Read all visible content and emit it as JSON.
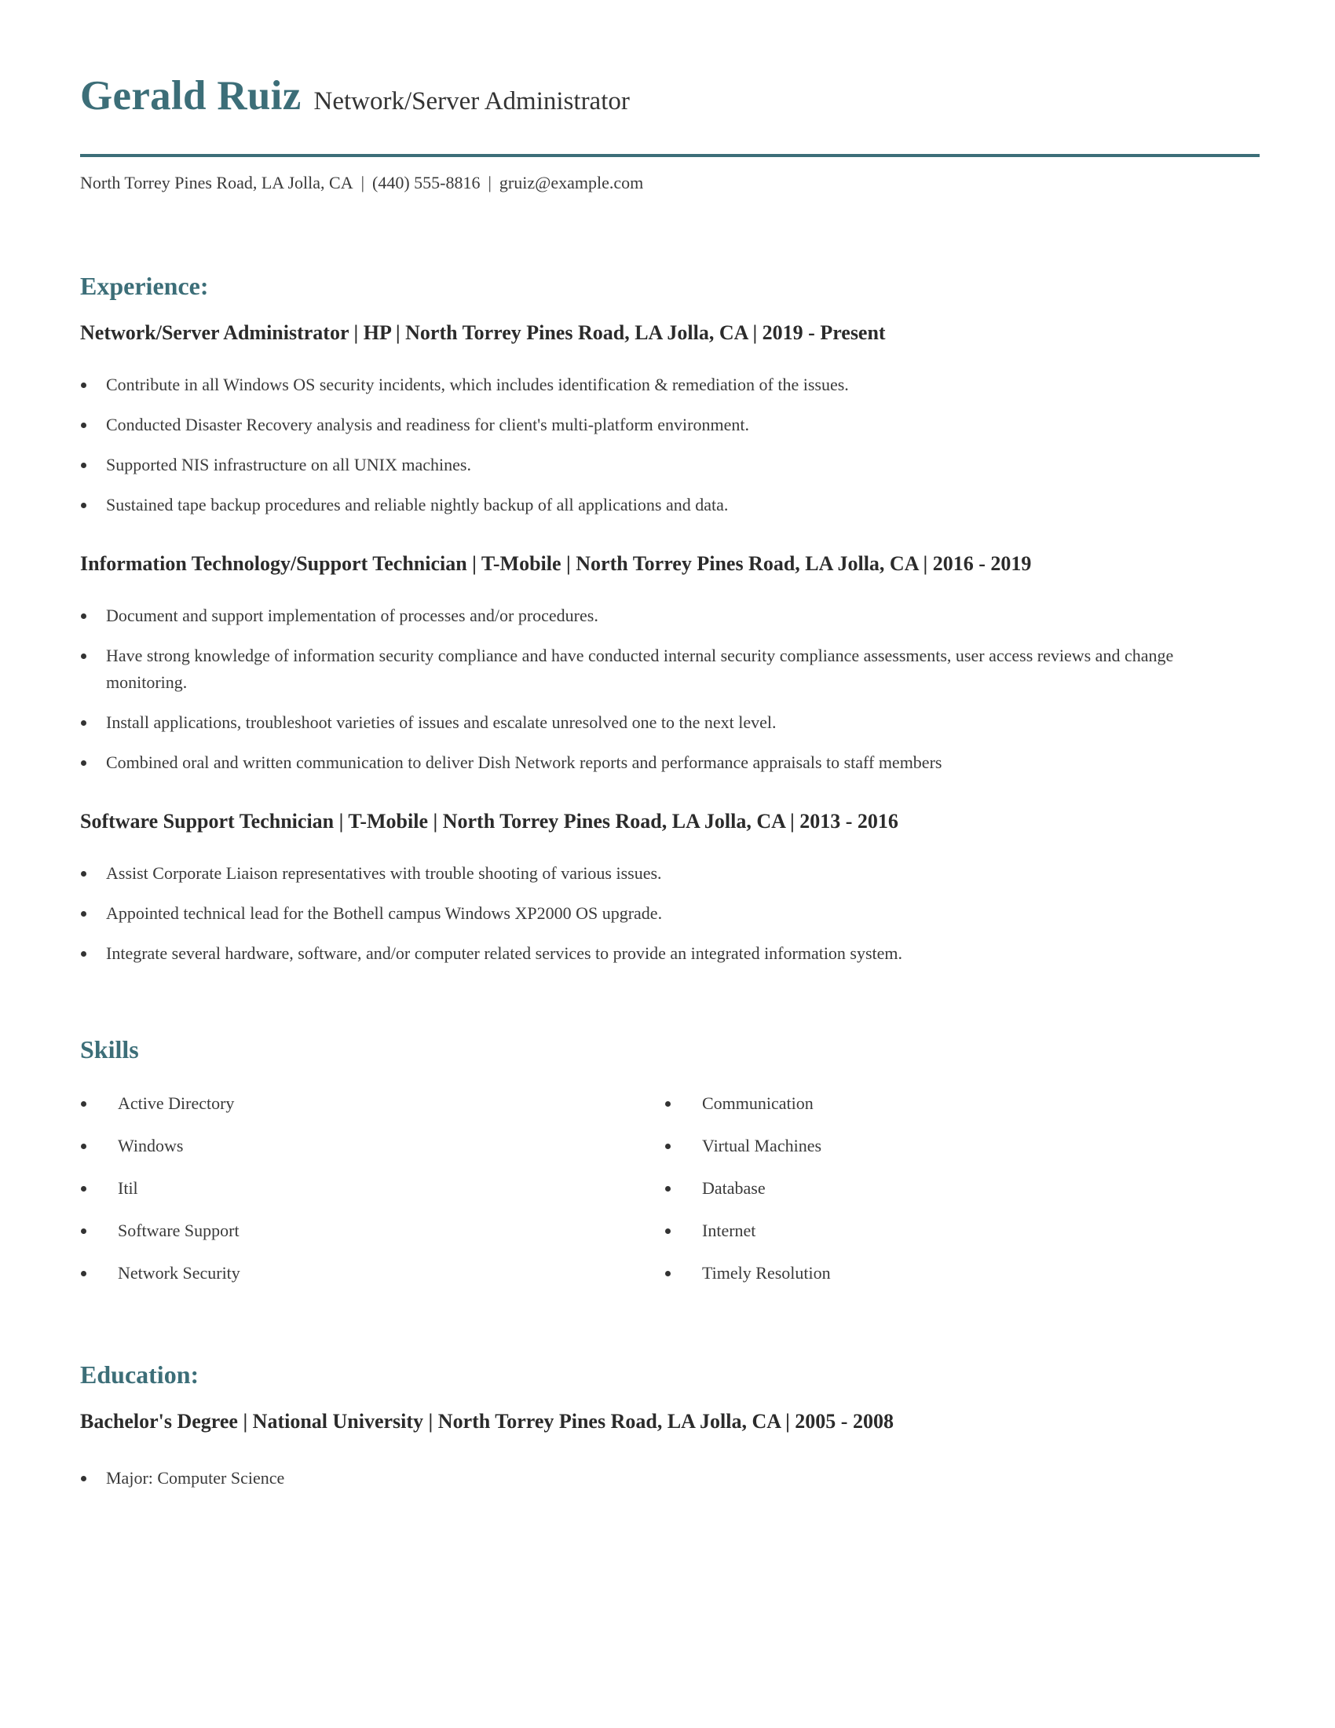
{
  "header": {
    "name": "Gerald Ruiz",
    "title": "Network/Server Administrator",
    "contact": {
      "address": "North Torrey Pines Road, LA Jolla, CA",
      "phone": "(440) 555-8816",
      "email": "gruiz@example.com",
      "separator": "|"
    }
  },
  "accent_color": "#3c6e78",
  "experience": {
    "heading": "Experience:",
    "jobs": [
      {
        "header": "Network/Server Administrator | HP | North Torrey Pines Road, LA Jolla, CA |  2019 - Present",
        "bullets": [
          "Contribute in all Windows OS security incidents, which includes identification & remediation of the issues.",
          "Conducted Disaster Recovery analysis and readiness for client's multi-platform environment.",
          "Supported NIS infrastructure on all UNIX machines.",
          "Sustained tape backup procedures and reliable nightly backup of all applications and data."
        ]
      },
      {
        "header": "Information Technology/Support Technician | T-Mobile | North Torrey Pines Road, LA Jolla, CA |  2016 - 2019",
        "bullets": [
          "Document and support implementation of processes and/or procedures.",
          "Have strong knowledge of information security compliance and have conducted internal security compliance assessments, user access reviews and change monitoring.",
          "Install applications, troubleshoot varieties of issues and escalate unresolved one to the next level.",
          "Combined oral and written communication to deliver Dish Network reports and performance appraisals to staff members"
        ]
      },
      {
        "header": "Software Support Technician | T-Mobile | North Torrey Pines Road, LA Jolla, CA |  2013 - 2016",
        "bullets": [
          "Assist Corporate Liaison representatives with trouble shooting of various issues.",
          "Appointed technical lead for the Bothell campus Windows XP2000 OS upgrade.",
          "Integrate several hardware, software, and/or computer related services to provide an integrated information system."
        ]
      }
    ]
  },
  "skills": {
    "heading": "Skills",
    "left": [
      "Active Directory",
      "Windows",
      "Itil",
      "Software Support",
      "Network Security"
    ],
    "right": [
      "Communication",
      "Virtual Machines",
      "Database",
      "Internet",
      "Timely Resolution"
    ]
  },
  "education": {
    "heading": "Education:",
    "entries": [
      {
        "header": "Bachelor's Degree | National University | North Torrey Pines Road, LA Jolla, CA |  2005 - 2008",
        "bullets": [
          "Major: Computer Science"
        ]
      }
    ]
  }
}
